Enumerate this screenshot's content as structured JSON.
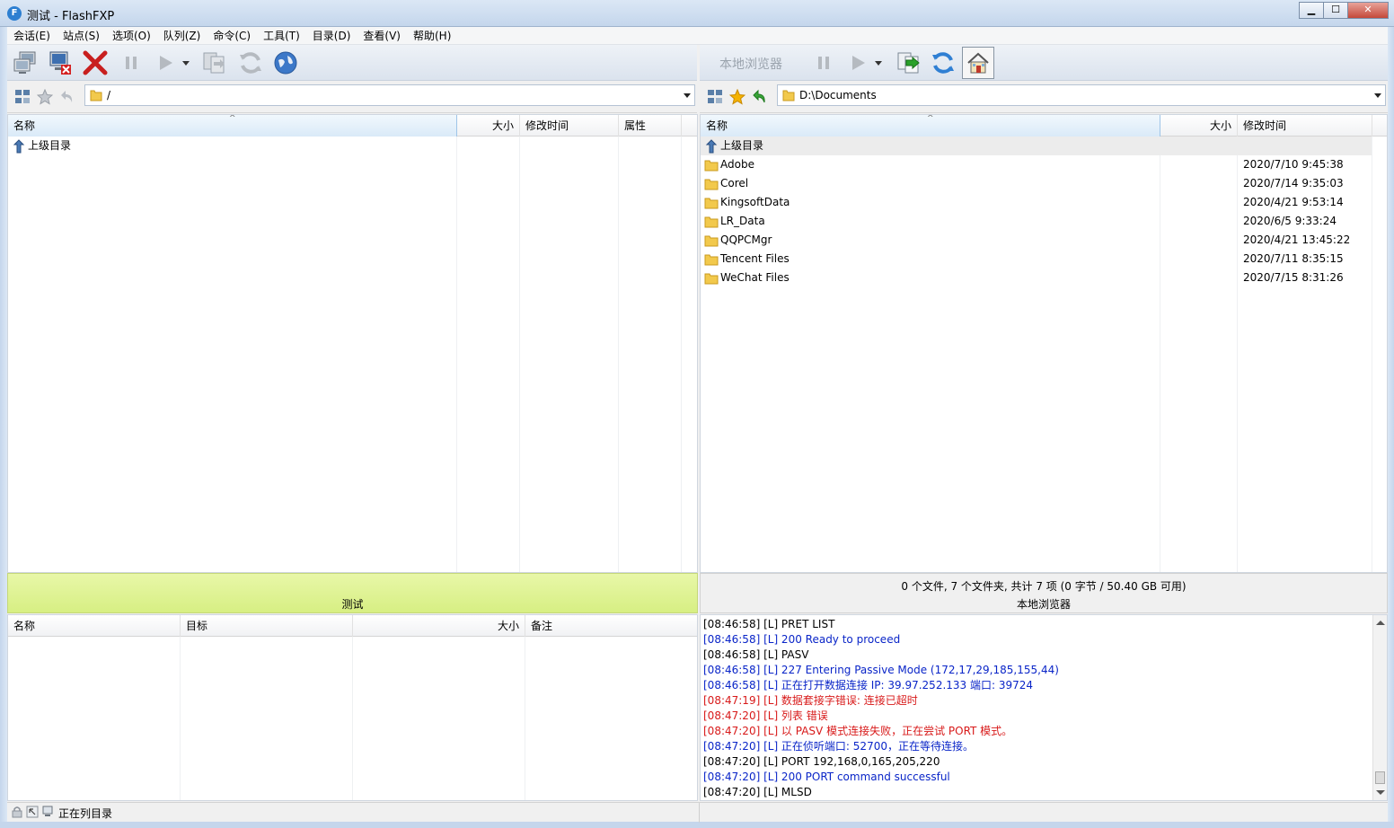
{
  "window": {
    "title": "测试 - FlashFXP",
    "app_icon": "flashfxp-icon",
    "controls": {
      "minimize": "▁",
      "maximize": "☐",
      "close": "✕"
    }
  },
  "menu": [
    "会话(E)",
    "站点(S)",
    "选项(O)",
    "队列(Z)",
    "命令(C)",
    "工具(T)",
    "目录(D)",
    "查看(V)",
    "帮助(H)"
  ],
  "left": {
    "path": "/",
    "columns": {
      "name": "名称",
      "size": "大小",
      "modified": "修改时间",
      "attributes": "属性"
    },
    "parent_label": "上级目录",
    "status_label": "测试"
  },
  "right": {
    "toolbar_label": "本地浏览器",
    "path": "D:\\Documents",
    "columns": {
      "name": "名称",
      "size": "大小",
      "modified": "修改时间"
    },
    "parent_label": "上级目录",
    "files": [
      {
        "name": "Adobe",
        "modified": "2020/7/10 9:45:38"
      },
      {
        "name": "Corel",
        "modified": "2020/7/14 9:35:03"
      },
      {
        "name": "KingsoftData",
        "modified": "2020/4/21 9:53:14"
      },
      {
        "name": "LR_Data",
        "modified": "2020/6/5 9:33:24"
      },
      {
        "name": "QQPCMgr",
        "modified": "2020/4/21 13:45:22"
      },
      {
        "name": "Tencent Files",
        "modified": "2020/7/11 8:35:15"
      },
      {
        "name": "WeChat Files",
        "modified": "2020/7/15 8:31:26"
      }
    ],
    "summary": "0 个文件, 7 个文件夹, 共计 7 项 (0 字节 / 50.40 GB 可用)",
    "status_label": "本地浏览器"
  },
  "queue": {
    "columns": {
      "name": "名称",
      "target": "目标",
      "size": "大小",
      "note": "备注"
    }
  },
  "log": [
    {
      "text": "[08:46:58]  [L] PRET LIST",
      "color": "black"
    },
    {
      "text": "[08:46:58]  [L] 200 Ready to proceed",
      "color": "blue"
    },
    {
      "text": "[08:46:58]  [L] PASV",
      "color": "black"
    },
    {
      "text": "[08:46:58]  [L] 227 Entering Passive Mode (172,17,29,185,155,44)",
      "color": "blue"
    },
    {
      "text": "[08:46:58]  [L] 正在打开数据连接 IP: 39.97.252.133 端口: 39724",
      "color": "blue"
    },
    {
      "text": "[08:47:19]  [L] 数据套接字错误: 连接已超时",
      "color": "red"
    },
    {
      "text": "[08:47:20]  [L] 列表 错误",
      "color": "red"
    },
    {
      "text": "[08:47:20]  [L] 以 PASV 模式连接失败，正在尝试 PORT 模式。",
      "color": "red"
    },
    {
      "text": "[08:47:20]  [L] 正在侦听端口: 52700，正在等待连接。",
      "color": "blue"
    },
    {
      "text": "[08:47:20]  [L] PORT 192,168,0,165,205,220",
      "color": "black"
    },
    {
      "text": "[08:47:20]  [L] 200 PORT command successful",
      "color": "blue"
    },
    {
      "text": "[08:47:20]  [L] MLSD",
      "color": "black"
    }
  ],
  "statusbar": {
    "text": "正在列目录"
  }
}
